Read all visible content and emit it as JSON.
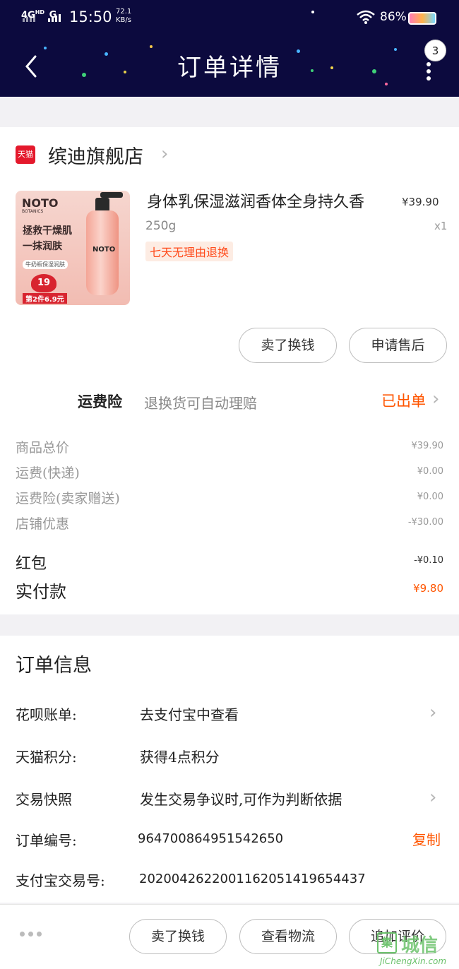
{
  "status_bar": {
    "network": "4G",
    "network_sup": "HD",
    "network2": "G",
    "time": "15:50",
    "speed_value": "72.1",
    "speed_unit": "KB/s",
    "battery": "86%",
    "icons": [
      "signal-icon",
      "wifi-icon",
      "battery-icon"
    ]
  },
  "header": {
    "title": "订单详情",
    "badge_count": "3",
    "back_icon": "chevron-left-icon",
    "more_icon": "more-vertical-icon"
  },
  "store": {
    "platform_icon_text": "天猫",
    "name": "缤迪旗舰店",
    "chevron": "›"
  },
  "product": {
    "image_text": {
      "brand": "NOTO",
      "brand_sub": "BOTANICS",
      "line1": "拯救干燥肌",
      "line2": "一抹润肤",
      "tag": "牛奶瓶保湿润肤",
      "badge": "19",
      "deal": "第2件6.9元",
      "bottle_label": "NOTO"
    },
    "title": "身体乳保湿滋润香体全身持久香",
    "price": "¥39.90",
    "spec": "250g",
    "quantity": "x1",
    "return_policy": "七天无理由退换"
  },
  "actions": {
    "sell_exchange": "卖了换钱",
    "after_sale": "申请售后"
  },
  "insurance": {
    "label": "运费险",
    "description": "退换货可自动理赔",
    "status": "已出单",
    "chevron": "›"
  },
  "fees": [
    {
      "label": "商品总价",
      "value": "¥39.90"
    },
    {
      "label": "运费(快递)",
      "value": "¥0.00"
    },
    {
      "label": "运费险(卖家赠送)",
      "value": "¥0.00"
    },
    {
      "label": "店铺优惠",
      "value": "-¥30.00"
    }
  ],
  "red_packet": {
    "label": "红包",
    "value": "-¥0.10"
  },
  "paid": {
    "label": "实付款",
    "value": "¥9.80"
  },
  "order_info": {
    "title": "订单信息",
    "rows": [
      {
        "key": "花呗账单:",
        "value": "去支付宝中查看",
        "chevron": "›"
      },
      {
        "key": "天猫积分:",
        "value": "获得4点积分"
      },
      {
        "key": "交易快照",
        "value": "发生交易争议时,可作为判断依据",
        "chevron": "›"
      },
      {
        "key": "订单编号:",
        "value": "964700864951542650",
        "action": "复制"
      },
      {
        "key": "支付宝交易号:",
        "value": "2020042622001162051419654437"
      }
    ]
  },
  "bottom_bar": {
    "more_icon": "more-horizontal-icon",
    "buttons": [
      "卖了换钱",
      "查看物流",
      "追加评价"
    ]
  },
  "watermark": {
    "box": "集",
    "text": "城信",
    "url": "JiChengXin.com"
  },
  "colors": {
    "header_bg": "#0c0a3e",
    "accent_orange": "#ff5500",
    "return_red": "#ff4a1a",
    "tmall_red": "#e4192c"
  }
}
